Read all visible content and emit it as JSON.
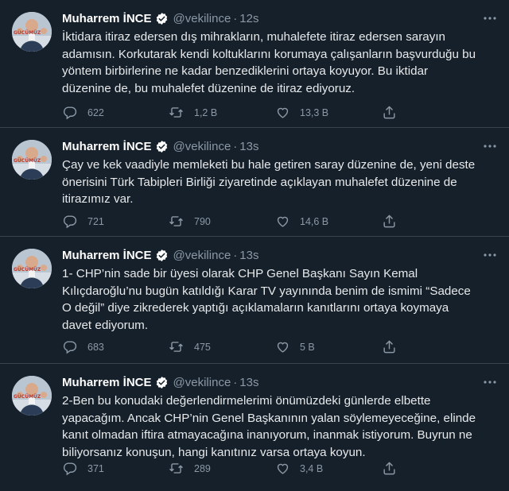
{
  "tweets": [
    {
      "name": "Muharrem İNCE",
      "handle": "@vekilince",
      "separator": "·",
      "time": "12s",
      "text": "İktidara itiraz edersen dış mihrakların, muhalefete itiraz edersen sarayın\nadamısın. Korkutarak kendi koltuklarını korumaya çalışanların başvurduğu bu\nyöntem birbirlerine ne kadar benzediklerini ortaya koyuyor. Bu iktidar\ndüzenine de, bu muhalefet düzenine de itiraz ediyoruz.",
      "replies": "622",
      "retweets": "1,2 B",
      "likes": "13,3 B"
    },
    {
      "name": "Muharrem İNCE",
      "handle": "@vekilince",
      "separator": "·",
      "time": "13s",
      "text": "Çay ve kek vaadiyle memleketi bu hale getiren saray düzenine de, yeni deste\nönerisini Türk Tabipleri Birliği ziyaretinde açıklayan muhalefet düzenine de\nitirazımız var.",
      "replies": "721",
      "retweets": "790",
      "likes": "14,6 B"
    },
    {
      "name": "Muharrem İNCE",
      "handle": "@vekilince",
      "separator": "·",
      "time": "13s",
      "text": "1- CHP’nin sade bir üyesi olarak CHP Genel Başkanı Sayın Kemal\nKılıçdaroğlu’nu bugün katıldığı Karar TV yayınında benim de ismimi “Sadece\nO değil” diye zikrederek yaptığı açıklamaların kanıtlarını ortaya koymaya\ndavet ediyorum.",
      "replies": "683",
      "retweets": "475",
      "likes": "5 B"
    },
    {
      "name": "Muharrem İNCE",
      "handle": "@vekilince",
      "separator": "·",
      "time": "13s",
      "text": "2-Ben bu konudaki değerlendirmelerimi önümüzdeki günlerde elbette\nyapacağım. Ancak CHP’nin Genel Başkanının yalan söylemeyeceğine, elinde\nkanıt olmadan iftira atmayacağına inanıyorum, inanmak istiyorum. Buyrun ne\nbiliyorsanız konuşun, hangi kanıtınız varsa ortaya koyun.",
      "replies": "371",
      "retweets": "289",
      "likes": "3,4 B"
    }
  ],
  "icons": {
    "reply": "reply-icon",
    "retweet": "retweet-icon",
    "like": "heart-icon",
    "share": "share-icon",
    "more": "more-icon",
    "verified": "verified-badge-icon"
  },
  "colors": {
    "background": "#15202b",
    "divider": "#38444d",
    "text": "#e7e9ea",
    "muted": "#8b98a5",
    "verified": "#ffffff"
  }
}
